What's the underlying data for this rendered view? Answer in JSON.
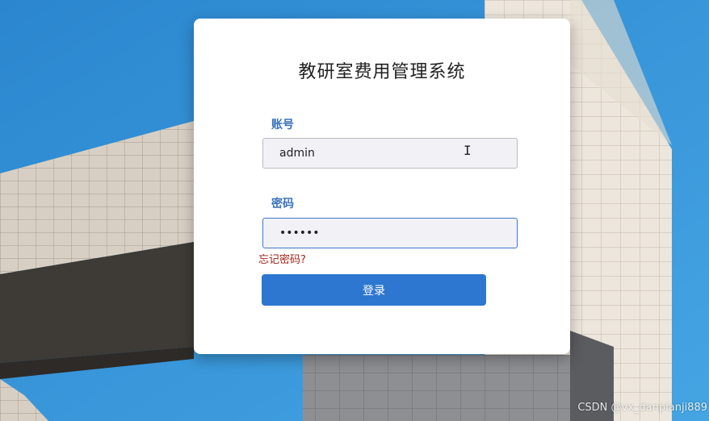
{
  "window": {
    "title": "教研室费用管理系统"
  },
  "login": {
    "account_label": "账号",
    "account_value": "admin",
    "password_label": "密码",
    "password_value": "••••••",
    "forgot_link": "忘记密码?",
    "submit_label": "登录"
  },
  "watermark": "CSDN @vx_danpianji889",
  "colors": {
    "accent": "#2d77d0",
    "label": "#3a73b9",
    "link_error": "#a52418",
    "sky": "#2f8fd4"
  }
}
